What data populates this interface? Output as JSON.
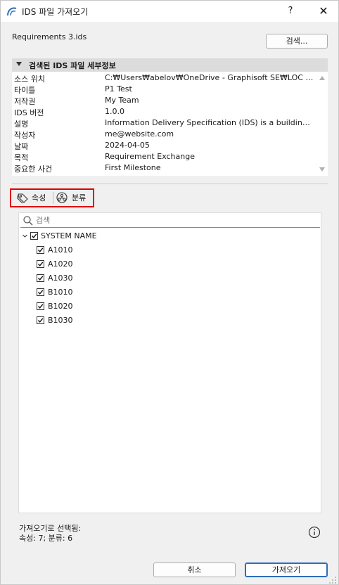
{
  "window": {
    "title": "IDS 파일 가져오기",
    "help": "?",
    "close": "✕"
  },
  "requirements_file": "Requirements 3.ids",
  "search_button": "검색...",
  "details": {
    "header": "검색된 IDS 파일 세부정보",
    "rows": [
      {
        "key": "소스 위치",
        "value": "C:₩Users₩abelov₩OneDrive - Graphisoft SE₩LOC IMGs₩..."
      },
      {
        "key": "타이틀",
        "value": "P1 Test"
      },
      {
        "key": "저작권",
        "value": "My Team"
      },
      {
        "key": "IDS 버전",
        "value": "1.0.0"
      },
      {
        "key": "설명",
        "value": "Information Delivery Specification (IDS) is a buildingSMA..."
      },
      {
        "key": "작성자",
        "value": "me@website.com"
      },
      {
        "key": "날짜",
        "value": "2024-04-05"
      },
      {
        "key": "목적",
        "value": "Requirement Exchange"
      },
      {
        "key": "중요한 사건",
        "value": "First Milestone"
      }
    ]
  },
  "tabs": [
    {
      "label": "속성",
      "icon": "tag-icon"
    },
    {
      "label": "분류",
      "icon": "classification-icon"
    }
  ],
  "tree": {
    "search_placeholder": "검색",
    "root": {
      "label": "SYSTEM NAME",
      "checked": true,
      "expanded": true
    },
    "children": [
      {
        "label": "A1010",
        "checked": true
      },
      {
        "label": "A1020",
        "checked": true
      },
      {
        "label": "A1030",
        "checked": true
      },
      {
        "label": "B1010",
        "checked": true
      },
      {
        "label": "B1020",
        "checked": true
      },
      {
        "label": "B1030",
        "checked": true
      }
    ]
  },
  "status": {
    "line1": "가져오기로 선택됨:",
    "line2": "속성: 7; 분류: 6"
  },
  "buttons": {
    "cancel": "취소",
    "import": "가져오기"
  },
  "colors": {
    "highlight_border": "#e00000",
    "primary_button_border": "#2a6ebd",
    "window_background": "#f0f0f0"
  }
}
